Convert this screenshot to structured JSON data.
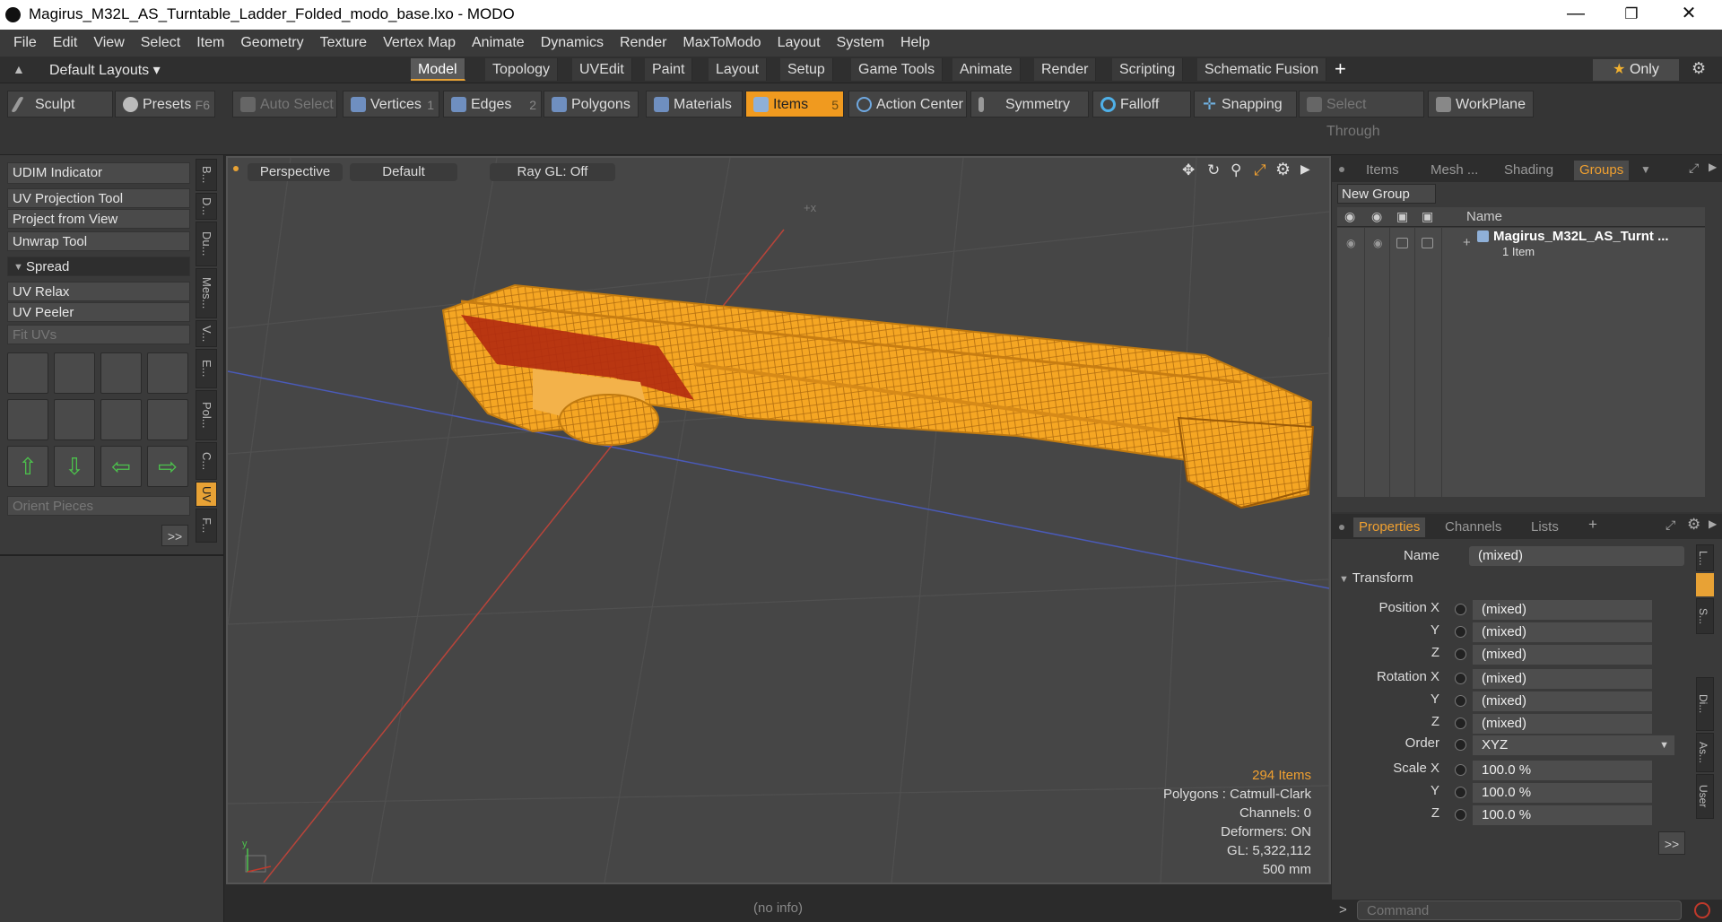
{
  "window": {
    "title": "Magirus_M32L_AS_Turntable_Ladder_Folded_modo_base.lxo - MODO"
  },
  "menu": [
    "File",
    "Edit",
    "View",
    "Select",
    "Item",
    "Geometry",
    "Texture",
    "Vertex Map",
    "Animate",
    "Dynamics",
    "Render",
    "MaxToModo",
    "Layout",
    "System",
    "Help"
  ],
  "layouts": {
    "label": "Default Layouts"
  },
  "tabs": [
    "Model",
    "Topology",
    "UVEdit",
    "Paint",
    "Layout",
    "Setup",
    "Game Tools",
    "Animate",
    "Render",
    "Scripting",
    "Schematic Fusion"
  ],
  "only_label": "Only",
  "toolbar": {
    "sculpt": "Sculpt",
    "presets": "Presets",
    "presets_key": "F6",
    "auto_select": "Auto Select",
    "vertices": "Vertices",
    "vertices_key": "1",
    "edges": "Edges",
    "edges_key": "2",
    "polygons": "Polygons",
    "materials": "Materials",
    "items": "Items",
    "items_key": "5",
    "action_center": "Action Center",
    "symmetry": "Symmetry",
    "falloff": "Falloff",
    "snapping": "Snapping",
    "select_through": "Select Through",
    "workplane": "WorkPlane"
  },
  "left": {
    "udim": "UDIM Indicator",
    "uvproj": "UV Projection Tool",
    "projview": "Project from View",
    "unwrap": "Unwrap Tool",
    "spread": "Spread",
    "relax": "UV Relax",
    "peeler": "UV Peeler",
    "fituvs": "Fit UVs",
    "orient": "Orient Pieces",
    "more": ">>",
    "vtabs": [
      "B...",
      "D...",
      "Du...",
      "Mes...",
      "V...",
      "E...",
      "Pol...",
      "C...",
      "UV",
      "F..."
    ]
  },
  "viewport": {
    "view": "Perspective",
    "shading": "Default",
    "raygl": "Ray GL: Off",
    "items_count": "294 Items",
    "polygons": "Polygons : Catmull-Clark",
    "channels": "Channels: 0",
    "deformers": "Deformers: ON",
    "gl": "GL: 5,322,112",
    "scale": "500 mm"
  },
  "status": "(no info)",
  "groups": {
    "tabs": [
      "Items",
      "Mesh ...",
      "Shading",
      "Groups"
    ],
    "new_group": "New Group",
    "col_name": "Name",
    "item_name": "Magirus_M32L_AS_Turnt ...",
    "item_sub": "1 Item"
  },
  "props": {
    "tabs": [
      "Properties",
      "Channels",
      "Lists"
    ],
    "name_label": "Name",
    "name_val": "(mixed)",
    "transform": "Transform",
    "pos_x": "Position X",
    "y": "Y",
    "z": "Z",
    "rot_x": "Rotation X",
    "order": "Order",
    "order_val": "XYZ",
    "scale_x": "Scale X",
    "mixed": "(mixed)",
    "pct": "100.0 %",
    "more": ">>",
    "side": [
      "L...",
      "S...",
      "Di...",
      "As...",
      "User"
    ]
  },
  "command": {
    "placeholder": "Command",
    "prompt": ">"
  }
}
